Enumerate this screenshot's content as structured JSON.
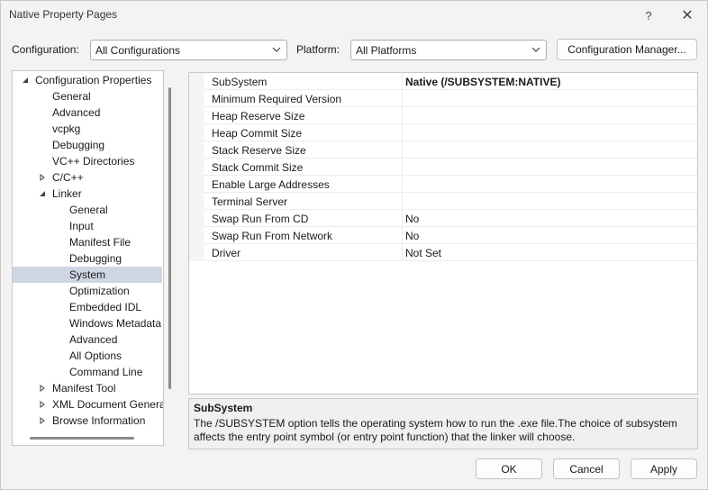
{
  "window": {
    "title": "Native Property Pages",
    "help_glyph": "?",
    "close_glyph": "✕"
  },
  "toolbar": {
    "configuration_label": "Configuration:",
    "configuration_value": "All Configurations",
    "platform_label": "Platform:",
    "platform_value": "All Platforms",
    "config_manager_label": "Configuration Manager..."
  },
  "tree": {
    "items": [
      {
        "label": "Configuration Properties",
        "expander": "expanded"
      },
      {
        "label": "General",
        "expander": "none"
      },
      {
        "label": "Advanced",
        "expander": "none"
      },
      {
        "label": "vcpkg",
        "expander": "none"
      },
      {
        "label": "Debugging",
        "expander": "none"
      },
      {
        "label": "VC++ Directories",
        "expander": "none"
      },
      {
        "label": "C/C++",
        "expander": "collapsed"
      },
      {
        "label": "Linker",
        "expander": "expanded"
      },
      {
        "label": "General",
        "expander": "none"
      },
      {
        "label": "Input",
        "expander": "none"
      },
      {
        "label": "Manifest File",
        "expander": "none"
      },
      {
        "label": "Debugging",
        "expander": "none"
      },
      {
        "label": "System",
        "expander": "none",
        "selected": true
      },
      {
        "label": "Optimization",
        "expander": "none"
      },
      {
        "label": "Embedded IDL",
        "expander": "none"
      },
      {
        "label": "Windows Metadata",
        "expander": "none"
      },
      {
        "label": "Advanced",
        "expander": "none"
      },
      {
        "label": "All Options",
        "expander": "none"
      },
      {
        "label": "Command Line",
        "expander": "none"
      },
      {
        "label": "Manifest Tool",
        "expander": "collapsed"
      },
      {
        "label": "XML Document Genera",
        "expander": "collapsed"
      },
      {
        "label": "Browse Information",
        "expander": "collapsed"
      }
    ]
  },
  "properties": {
    "rows": [
      {
        "name": "SubSystem",
        "value": "Native (/SUBSYSTEM:NATIVE)",
        "bold": true
      },
      {
        "name": "Minimum Required Version",
        "value": ""
      },
      {
        "name": "Heap Reserve Size",
        "value": ""
      },
      {
        "name": "Heap Commit Size",
        "value": ""
      },
      {
        "name": "Stack Reserve Size",
        "value": ""
      },
      {
        "name": "Stack Commit Size",
        "value": ""
      },
      {
        "name": "Enable Large Addresses",
        "value": ""
      },
      {
        "name": "Terminal Server",
        "value": ""
      },
      {
        "name": "Swap Run From CD",
        "value": "No"
      },
      {
        "name": "Swap Run From Network",
        "value": "No"
      },
      {
        "name": "Driver",
        "value": "Not Set"
      }
    ]
  },
  "description": {
    "title": "SubSystem",
    "text": "The /SUBSYSTEM option tells the operating system how to run the .exe file.The choice of subsystem affects the entry point symbol (or entry point function) that the linker will choose."
  },
  "buttons": {
    "ok": "OK",
    "cancel": "Cancel",
    "apply": "Apply"
  }
}
